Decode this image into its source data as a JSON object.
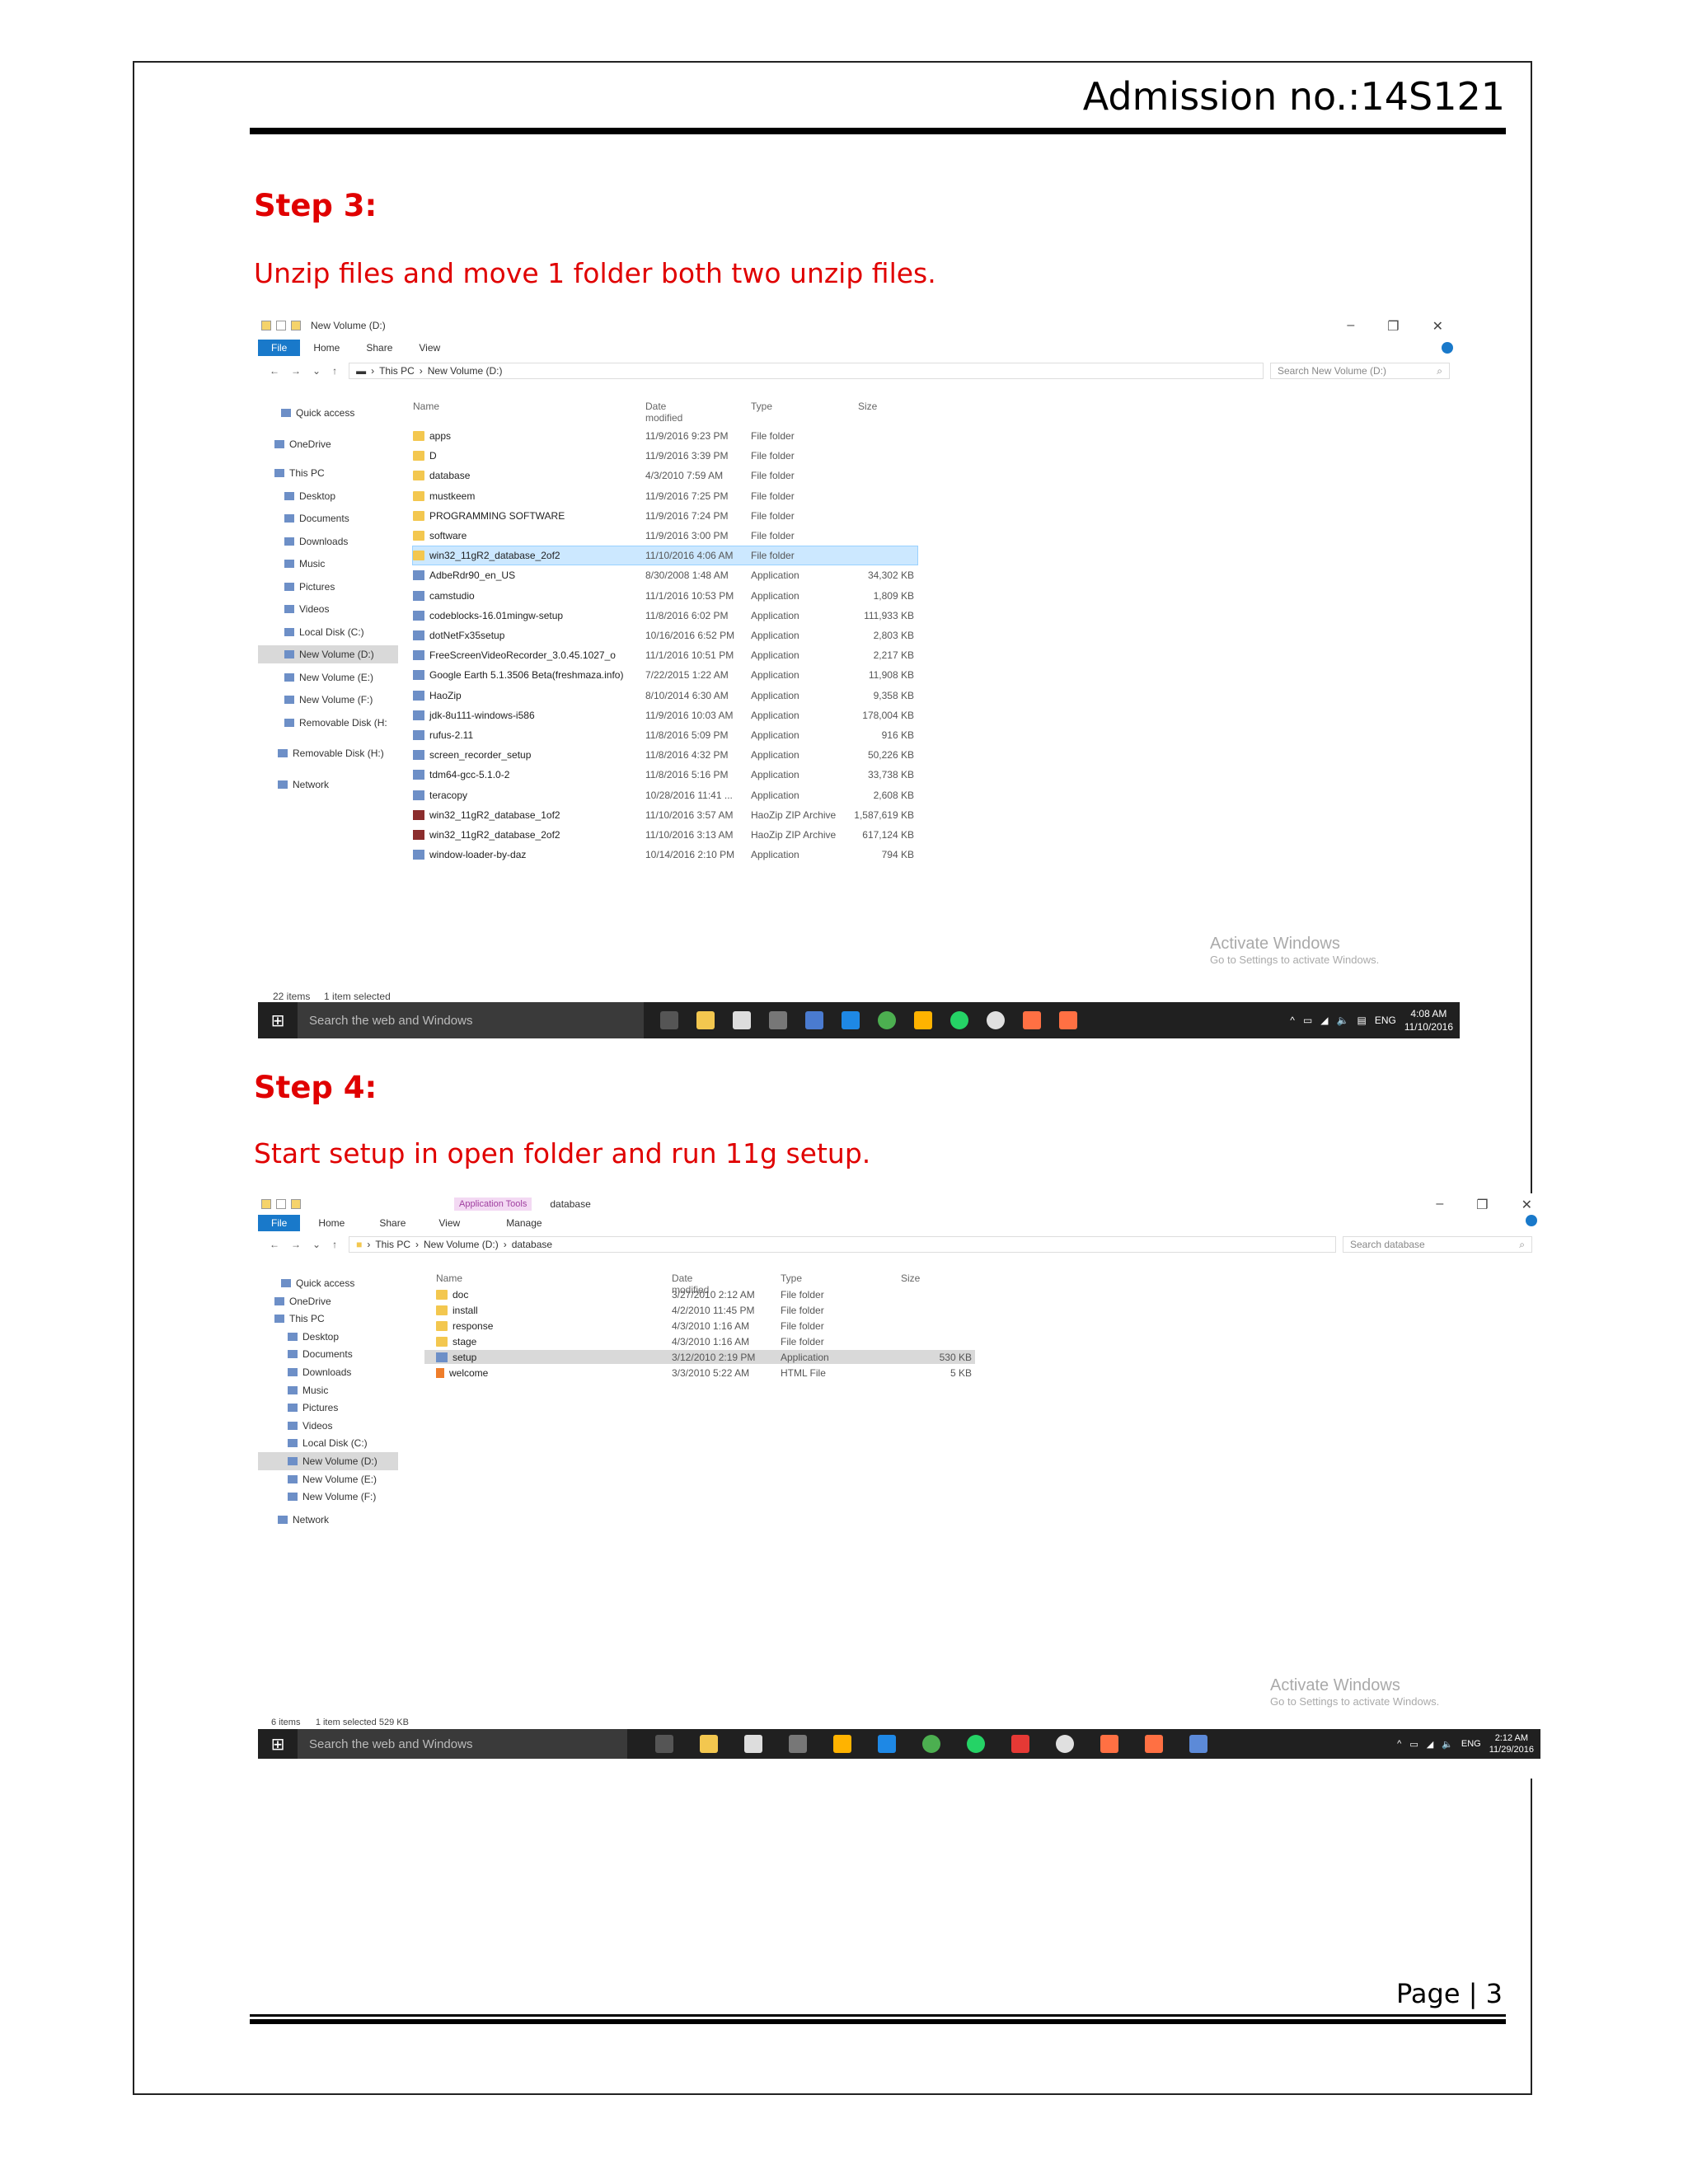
{
  "header": {
    "admission": "Admission no.:14S121"
  },
  "steps": [
    {
      "title": "Step 3:",
      "desc": "Unzip files and move 1 folder both two unzip files."
    },
    {
      "title": "Step 4:",
      "desc": "Start setup in open folder and run 11g setup."
    }
  ],
  "footer": {
    "page": "Page | 3"
  },
  "win1": {
    "title": "New Volume (D:)",
    "ribbon": [
      "File",
      "Home",
      "Share",
      "View"
    ],
    "path": [
      "This PC",
      "New Volume (D:)"
    ],
    "search_placeholder": "Search New Volume (D:)",
    "columns": [
      "Name",
      "Date modified",
      "Type",
      "Size"
    ],
    "nav": [
      "Quick access",
      "OneDrive",
      "This PC",
      "Desktop",
      "Documents",
      "Downloads",
      "Music",
      "Pictures",
      "Videos",
      "Local Disk (C:)",
      "New Volume (D:)",
      "New Volume (E:)",
      "New Volume (F:)",
      "Removable Disk (H:",
      "Removable Disk (H:)",
      "Network"
    ],
    "files": [
      {
        "name": "apps",
        "date": "11/9/2016 9:23 PM",
        "type": "File folder",
        "size": "",
        "icon": "folder"
      },
      {
        "name": "D",
        "date": "11/9/2016 3:39 PM",
        "type": "File folder",
        "size": "",
        "icon": "folder"
      },
      {
        "name": "database",
        "date": "4/3/2010 7:59 AM",
        "type": "File folder",
        "size": "",
        "icon": "folder"
      },
      {
        "name": "mustkeem",
        "date": "11/9/2016 7:25 PM",
        "type": "File folder",
        "size": "",
        "icon": "folder"
      },
      {
        "name": "PROGRAMMING SOFTWARE",
        "date": "11/9/2016 7:24 PM",
        "type": "File folder",
        "size": "",
        "icon": "folder"
      },
      {
        "name": "software",
        "date": "11/9/2016 3:00 PM",
        "type": "File folder",
        "size": "",
        "icon": "folder"
      },
      {
        "name": "win32_11gR2_database_2of2",
        "date": "11/10/2016 4:06 AM",
        "type": "File folder",
        "size": "",
        "icon": "folder"
      },
      {
        "name": "AdbeRdr90_en_US",
        "date": "8/30/2008 1:48 AM",
        "type": "Application",
        "size": "34,302 KB",
        "icon": "app"
      },
      {
        "name": "camstudio",
        "date": "11/1/2016 10:53 PM",
        "type": "Application",
        "size": "1,809 KB",
        "icon": "app"
      },
      {
        "name": "codeblocks-16.01mingw-setup",
        "date": "11/8/2016 6:02 PM",
        "type": "Application",
        "size": "111,933 KB",
        "icon": "app"
      },
      {
        "name": "dotNetFx35setup",
        "date": "10/16/2016 6:52 PM",
        "type": "Application",
        "size": "2,803 KB",
        "icon": "app"
      },
      {
        "name": "FreeScreenVideoRecorder_3.0.45.1027_o",
        "date": "11/1/2016 10:51 PM",
        "type": "Application",
        "size": "2,217 KB",
        "icon": "app"
      },
      {
        "name": "Google Earth 5.1.3506 Beta(freshmaza.info)",
        "date": "7/22/2015 1:22 AM",
        "type": "Application",
        "size": "11,908 KB",
        "icon": "app"
      },
      {
        "name": "HaoZip",
        "date": "8/10/2014 6:30 AM",
        "type": "Application",
        "size": "9,358 KB",
        "icon": "app"
      },
      {
        "name": "jdk-8u111-windows-i586",
        "date": "11/9/2016 10:03 AM",
        "type": "Application",
        "size": "178,004 KB",
        "icon": "app"
      },
      {
        "name": "rufus-2.11",
        "date": "11/8/2016 5:09 PM",
        "type": "Application",
        "size": "916 KB",
        "icon": "app"
      },
      {
        "name": "screen_recorder_setup",
        "date": "11/8/2016 4:32 PM",
        "type": "Application",
        "size": "50,226 KB",
        "icon": "app"
      },
      {
        "name": "tdm64-gcc-5.1.0-2",
        "date": "11/8/2016 5:16 PM",
        "type": "Application",
        "size": "33,738 KB",
        "icon": "app"
      },
      {
        "name": "teracopy",
        "date": "10/28/2016 11:41 ...",
        "type": "Application",
        "size": "2,608 KB",
        "icon": "app"
      },
      {
        "name": "win32_11gR2_database_1of2",
        "date": "11/10/2016 3:57 AM",
        "type": "HaoZip ZIP Archive",
        "size": "1,587,619 KB",
        "icon": "zip"
      },
      {
        "name": "win32_11gR2_database_2of2",
        "date": "11/10/2016 3:13 AM",
        "type": "HaoZip ZIP Archive",
        "size": "617,124 KB",
        "icon": "zip"
      },
      {
        "name": "window-loader-by-daz",
        "date": "10/14/2016 2:10 PM",
        "type": "Application",
        "size": "794 KB",
        "icon": "app"
      }
    ],
    "status_items": "22 items",
    "status_selected": "1 item selected",
    "activate_title": "Activate Windows",
    "activate_sub": "Go to Settings to activate Windows.",
    "taskbar_search": "Search the web and Windows",
    "time": "4:08 AM",
    "date": "11/10/2016",
    "lang": "ENG"
  },
  "win2": {
    "title": "database",
    "context_tab": "Application Tools",
    "ribbon": [
      "File",
      "Home",
      "Share",
      "View",
      "Manage"
    ],
    "path": [
      "This PC",
      "New Volume (D:)",
      "database"
    ],
    "search_placeholder": "Search database",
    "columns": [
      "Name",
      "Date modified",
      "Type",
      "Size"
    ],
    "nav": [
      "Quick access",
      "OneDrive",
      "This PC",
      "Desktop",
      "Documents",
      "Downloads",
      "Music",
      "Pictures",
      "Videos",
      "Local Disk (C:)",
      "New Volume (D:)",
      "New Volume (E:)",
      "New Volume (F:)",
      "Network"
    ],
    "files": [
      {
        "name": "doc",
        "date": "3/27/2010 2:12 AM",
        "type": "File folder",
        "size": "",
        "icon": "folder"
      },
      {
        "name": "install",
        "date": "4/2/2010 11:45 PM",
        "type": "File folder",
        "size": "",
        "icon": "folder"
      },
      {
        "name": "response",
        "date": "4/3/2010 1:16 AM",
        "type": "File folder",
        "size": "",
        "icon": "folder"
      },
      {
        "name": "stage",
        "date": "4/3/2010 1:16 AM",
        "type": "File folder",
        "size": "",
        "icon": "folder"
      },
      {
        "name": "setup",
        "date": "3/12/2010 2:19 PM",
        "type": "Application",
        "size": "530 KB",
        "icon": "app"
      },
      {
        "name": "welcome",
        "date": "3/3/2010 5:22 AM",
        "type": "HTML File",
        "size": "5 KB",
        "icon": "html"
      }
    ],
    "status_items": "6 items",
    "status_selected": "1 item selected  529 KB",
    "activate_title": "Activate Windows",
    "activate_sub": "Go to Settings to activate Windows.",
    "taskbar_search": "Search the web and Windows",
    "time": "2:12 AM",
    "date": "11/29/2016",
    "lang": "ENG"
  },
  "colors": {
    "step_red": "#e00000",
    "file_tab": "#1979ca",
    "selection": "#cce8ff",
    "taskbar": "#202020"
  }
}
